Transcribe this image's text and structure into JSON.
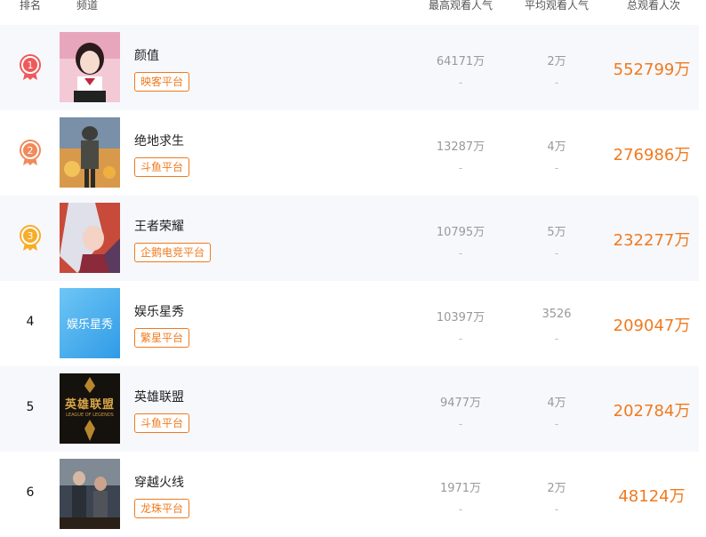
{
  "header": {
    "rank": "排名",
    "channel": "频道",
    "peak": "最高观看人气",
    "avg": "平均观看人气",
    "total": "总观看人次"
  },
  "rows": [
    {
      "rank": "1",
      "name": "颜值",
      "platform": "映客平台",
      "peak": "64171万",
      "peak_sub": "-",
      "avg": "2万",
      "avg_sub": "-",
      "total": "552799万"
    },
    {
      "rank": "2",
      "name": "绝地求生",
      "platform": "斗鱼平台",
      "peak": "13287万",
      "peak_sub": "-",
      "avg": "4万",
      "avg_sub": "-",
      "total": "276986万"
    },
    {
      "rank": "3",
      "name": "王者荣耀",
      "platform": "企鹅电竞平台",
      "peak": "10795万",
      "peak_sub": "-",
      "avg": "5万",
      "avg_sub": "-",
      "total": "232277万"
    },
    {
      "rank": "4",
      "name": "娱乐星秀",
      "platform": "繁星平台",
      "peak": "10397万",
      "peak_sub": "-",
      "avg": "3526",
      "avg_sub": "-",
      "total": "209047万",
      "thumb_text": "娱乐星秀"
    },
    {
      "rank": "5",
      "name": "英雄联盟",
      "platform": "斗鱼平台",
      "peak": "9477万",
      "peak_sub": "-",
      "avg": "4万",
      "avg_sub": "-",
      "total": "202784万",
      "thumb_text": "英雄联盟",
      "thumb_sub": "LEAGUE OF LEGENDS"
    },
    {
      "rank": "6",
      "name": "穿越火线",
      "platform": "龙珠平台",
      "peak": "1971万",
      "peak_sub": "-",
      "avg": "2万",
      "avg_sub": "-",
      "total": "48124万"
    }
  ],
  "colors": {
    "accent": "#f07a1f",
    "medal_gold": "#f7ad2a",
    "medal_silver": "#f08a5a",
    "medal_first": "#ee5a5a"
  },
  "icons": {
    "medal": "medal-icon"
  }
}
